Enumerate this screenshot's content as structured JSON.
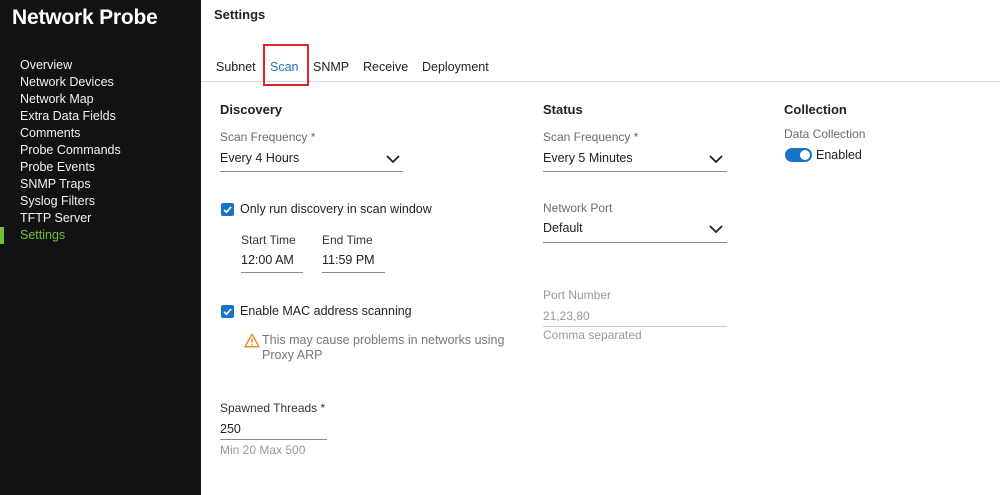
{
  "app": {
    "title": "Network Probe"
  },
  "sidebar": {
    "items": [
      {
        "label": "Overview"
      },
      {
        "label": "Network Devices"
      },
      {
        "label": "Network Map"
      },
      {
        "label": "Extra Data Fields"
      },
      {
        "label": "Comments"
      },
      {
        "label": "Probe Commands"
      },
      {
        "label": "Probe Events"
      },
      {
        "label": "SNMP Traps"
      },
      {
        "label": "Syslog Filters"
      },
      {
        "label": "TFTP Server"
      },
      {
        "label": "Settings",
        "active": true
      }
    ]
  },
  "header": {
    "title": "Settings"
  },
  "tabs": [
    {
      "label": "Subnet"
    },
    {
      "label": "Scan",
      "active": true
    },
    {
      "label": "SNMP"
    },
    {
      "label": "Receive"
    },
    {
      "label": "Deployment"
    }
  ],
  "discovery": {
    "title": "Discovery",
    "scan_frequency": {
      "label": "Scan Frequency *",
      "value": "Every 4 Hours"
    },
    "scan_window": {
      "label": "Only run discovery in scan window",
      "checked": true
    },
    "start_time": {
      "label": "Start Time",
      "value": "12:00 AM"
    },
    "end_time": {
      "label": "End Time",
      "value": "11:59 PM"
    },
    "mac_scanning": {
      "label": "Enable MAC address scanning",
      "checked": true
    },
    "warning": {
      "text": "This may cause problems in networks using Proxy ARP"
    },
    "spawned_threads": {
      "label": "Spawned Threads *",
      "value": "250",
      "helper": "Min 20 Max 500"
    }
  },
  "status": {
    "title": "Status",
    "scan_frequency": {
      "label": "Scan Frequency *",
      "value": "Every 5 Minutes"
    },
    "network_port": {
      "label": "Network Port",
      "value": "Default"
    },
    "port_number": {
      "label": "Port Number",
      "placeholder": "21,23,80",
      "helper": "Comma separated"
    }
  },
  "collection": {
    "title": "Collection",
    "data_collection": {
      "label": "Data Collection",
      "state_label": "Enabled",
      "enabled": true
    }
  },
  "colors": {
    "sidebar_bg": "#121212",
    "accent_green": "#6fbf3b",
    "accent_blue": "#1a73c9",
    "highlight_red": "#d8282a",
    "warning_orange": "#e8912d"
  },
  "icons": [
    "chevron-down-icon",
    "checkmark-icon",
    "warning-triangle-icon"
  ]
}
